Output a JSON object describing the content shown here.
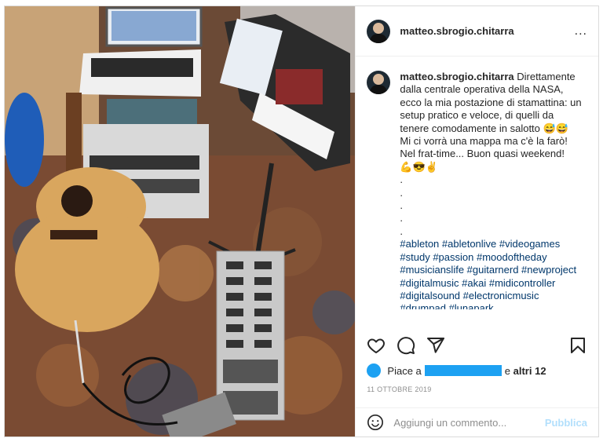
{
  "post": {
    "username": "matteo.sbrogio.chitarra",
    "caption_lines": "Direttamente dalla centrale operativa della NASA, ecco la mia postazione di stamattina: un setup pratico e veloce, di quelli da tenere comodamente in salotto 😅😅\nMi ci vorrà una mappa ma c'è la farò!\nNel frat-time... Buon quasi weekend!\n💪😎✌\n.\n.\n.\n.\n.",
    "hashtags": "#ableton #abletonlive #videogames #study #passion #moodoftheday #musicianslife #guitarnerd #newproject #digitalmusic #akai #midicontroller #digitalsound #electronicmusic #drumpad #lunapark",
    "likes_prefix": "Piace a",
    "likes_mid": "e",
    "likes_others": "altri 12",
    "date": "11 OTTOBRE 2019",
    "comment_placeholder": "Aggiungi un commento...",
    "publish_label": "Pubblica",
    "more_label": "..."
  }
}
